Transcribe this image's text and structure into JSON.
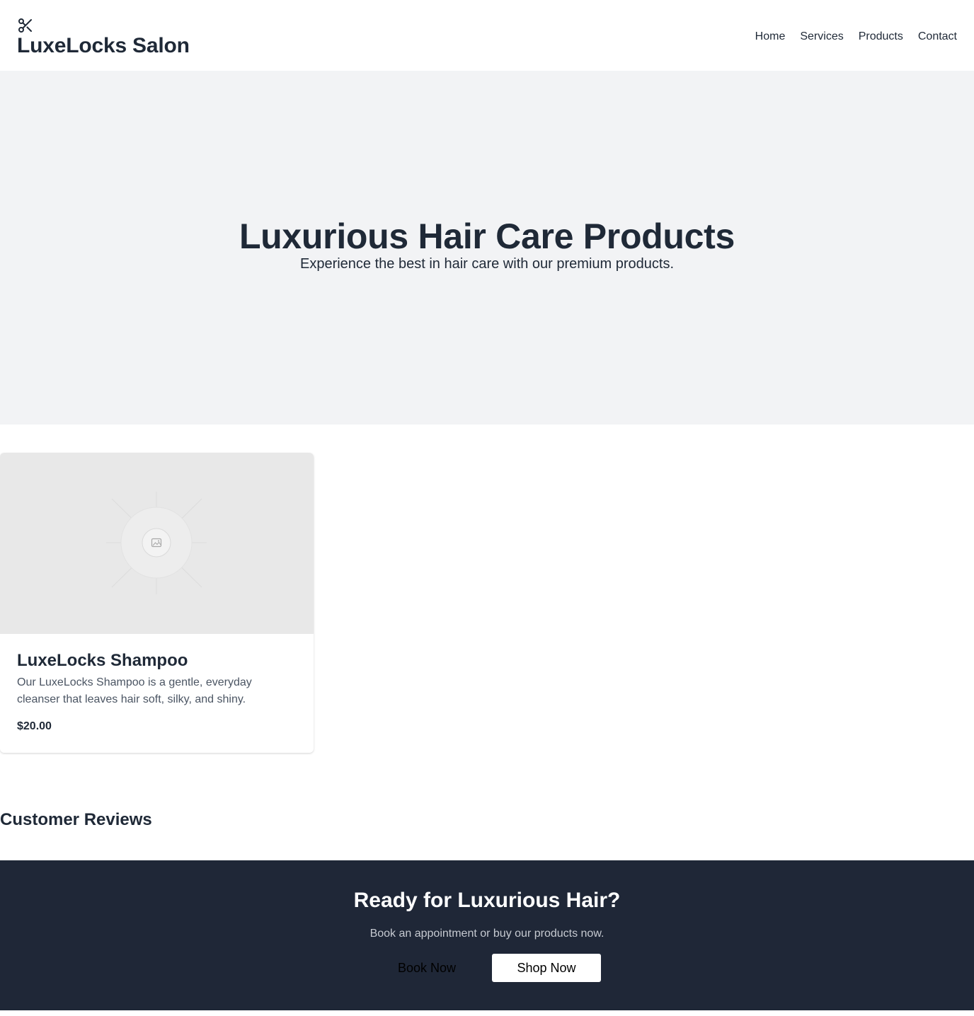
{
  "header": {
    "brand": "LuxeLocks Salon",
    "logo_icon": "scissors-icon",
    "nav": [
      "Home",
      "Services",
      "Products",
      "Contact"
    ]
  },
  "hero": {
    "title": "Luxurious Hair Care Products",
    "subtitle": "Experience the best in hair care with our premium products."
  },
  "products": [
    {
      "image_icon": "image-placeholder-icon",
      "name": "LuxeLocks Shampoo",
      "description": "Our LuxeLocks Shampoo is a gentle, everyday cleanser that leaves hair soft, silky, and shiny.",
      "price": "$20.00"
    }
  ],
  "reviews": {
    "title": "Customer Reviews"
  },
  "cta": {
    "title": "Ready for Luxurious Hair?",
    "subtitle": "Book an appointment or buy our products now.",
    "book_label": "Book Now",
    "shop_label": "Shop Now"
  },
  "colors": {
    "text": "#1f2937",
    "hero_bg": "#f2f3f5",
    "cta_bg": "#1f2737"
  }
}
